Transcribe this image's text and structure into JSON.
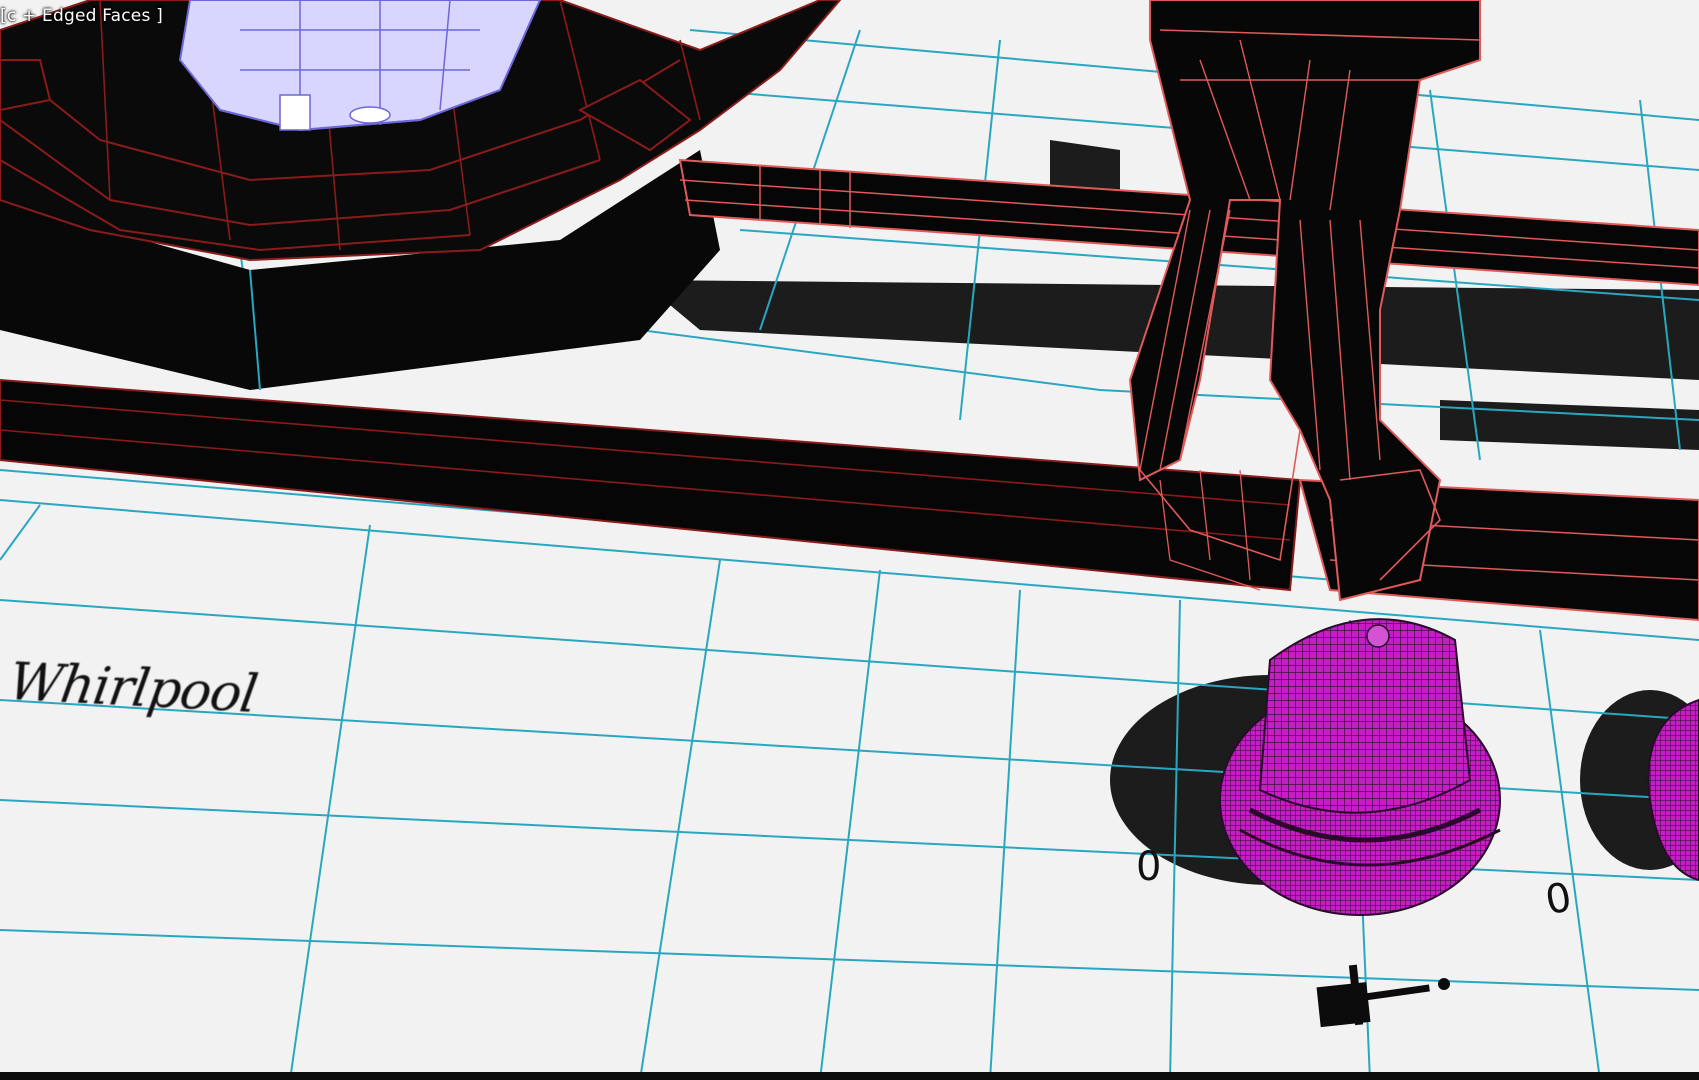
{
  "viewport": {
    "label": "[c + Edged Faces ]",
    "brand_decal": "Whirlpool",
    "dial_marks": [
      "0",
      "0"
    ],
    "colors": {
      "background": "#ffffff",
      "grid_wire": "#2aa7c0",
      "rail_wire": "#8a1b1b",
      "grate_wire": "#e15a5a",
      "knob_wire": "#c41ec4",
      "burner_wire": "#b9b6ff",
      "solid": "#000000"
    },
    "icons": [
      "knob-indicator-icon",
      "power-symbol-icon"
    ]
  }
}
